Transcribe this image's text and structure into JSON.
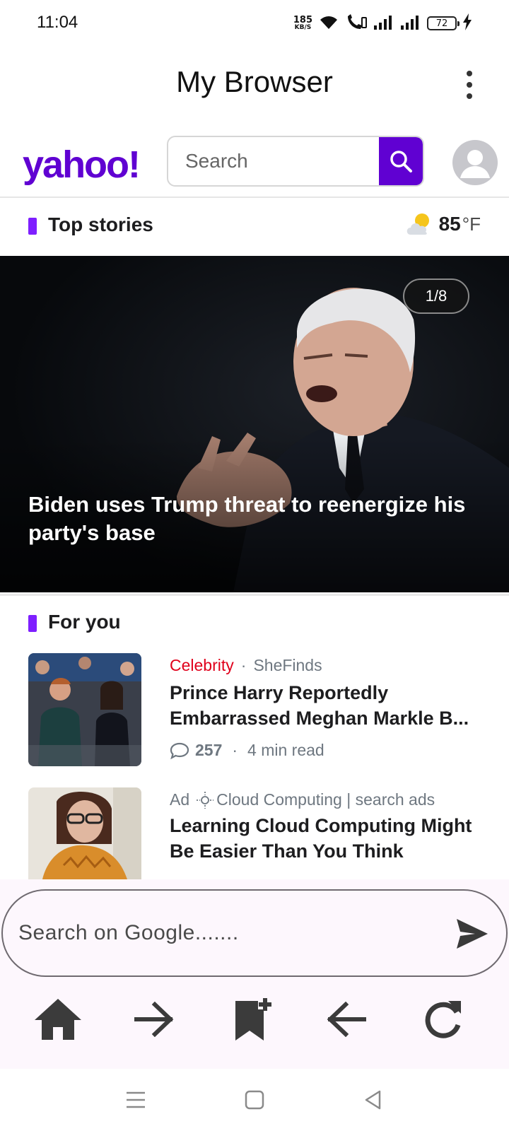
{
  "status_bar": {
    "time": "11:04",
    "net_speed": "185",
    "net_unit": "KB/S",
    "battery": "72",
    "icons": [
      "wifi-icon",
      "volte-call-icon",
      "signal-icon",
      "signal-icon",
      "battery-icon",
      "charging-icon"
    ]
  },
  "app_bar": {
    "title": "My Browser",
    "menu_icon": "more-vert-icon"
  },
  "yahoo": {
    "logo": "yahoo!",
    "search_placeholder": "Search",
    "search_icon": "search-icon",
    "avatar_icon": "profile-icon"
  },
  "top_stories": {
    "title": "Top stories",
    "weather_icon": "partly-cloudy-icon",
    "temperature": "85",
    "unit": "°F",
    "hero": {
      "slide_counter": "1/8",
      "headline": "Biden uses Trump threat to reenergize his party's base"
    }
  },
  "for_you": {
    "title": "For you",
    "articles": [
      {
        "category": "Celebrity",
        "source": "SheFinds",
        "title_line1": "Prince Harry Reportedly",
        "title_line2": "Embarrassed Meghan Markle B...",
        "comments": "257",
        "read_time": "4 min read"
      },
      {
        "ad_label": "Ad",
        "advertiser": "Cloud Computing | search ads",
        "title_line1": "Learning Cloud Computing Might",
        "title_line2": "Be Easier Than You Think"
      }
    ]
  },
  "browser_controls": {
    "search_placeholder": "Search on Google.......",
    "send_icon": "send-icon",
    "nav": [
      "home-icon",
      "forward-arrow-icon",
      "bookmark-add-icon",
      "back-arrow-icon",
      "refresh-icon"
    ]
  },
  "system_nav": [
    "menu-icon",
    "home-square-icon",
    "back-triangle-icon"
  ],
  "colors": {
    "yahoo_purple": "#6001d2",
    "section_accent": "#7e1fff",
    "category_red": "#e0001b",
    "panel_bg": "#fdf7fd"
  }
}
